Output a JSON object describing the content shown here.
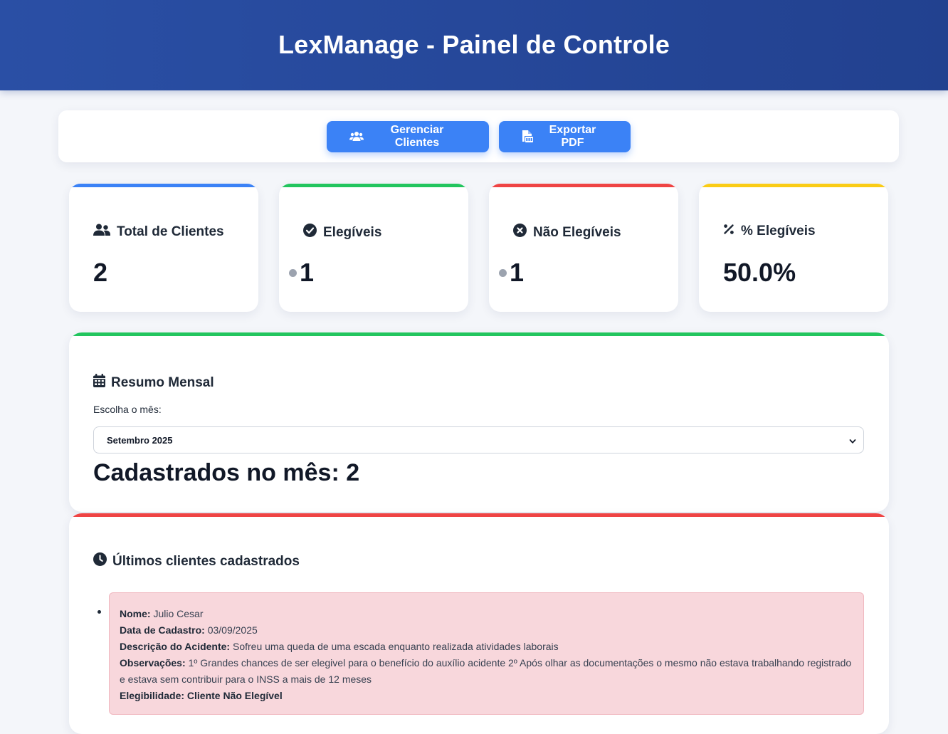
{
  "header": {
    "title": "LexManage - Painel de Controle"
  },
  "toolbar": {
    "manage_label": "Gerenciar Clientes",
    "export_label": "Exportar PDF"
  },
  "stats": [
    {
      "title": "Total de Clientes",
      "value": "2",
      "icon": "users-icon",
      "accent": "#3b82f6"
    },
    {
      "title": "Elegíveis",
      "value": "1",
      "icon": "check-circle-icon",
      "accent": "#22c55e"
    },
    {
      "title": "Não Elegíveis",
      "value": "1",
      "icon": "x-circle-icon",
      "accent": "#ef4444"
    },
    {
      "title": "% Elegíveis",
      "value": "50.0%",
      "icon": "percent-icon",
      "accent": "#facc15"
    }
  ],
  "monthly": {
    "title": "Resumo Mensal",
    "label": "Escolha o mês:",
    "selected": "Setembro 2025",
    "count_text": "Cadastrados no mês: 2",
    "accent": "#22c55e"
  },
  "recent": {
    "title": "Últimos clientes cadastrados",
    "accent": "#ef4444",
    "clients": [
      {
        "name_label": "Nome:",
        "name": "Julio Cesar",
        "date_label": "Data de Cadastro:",
        "date": "03/09/2025",
        "desc_label": "Descrição do Acidente:",
        "desc": "Sofreu uma queda de uma escada enquanto realizada atividades laborais",
        "obs_label": "Observações:",
        "obs": "1º Grandes chances de ser elegivel para o benefício do auxílio acidente 2º Após olhar as documentações o mesmo não estava trabalhando registrado e estava sem contribuir para o INSS a mais de 12 meses",
        "elig_label": "Elegibilidade:",
        "elig": "Cliente Não Elegível",
        "card_color": "#f8d7dc"
      }
    ]
  }
}
